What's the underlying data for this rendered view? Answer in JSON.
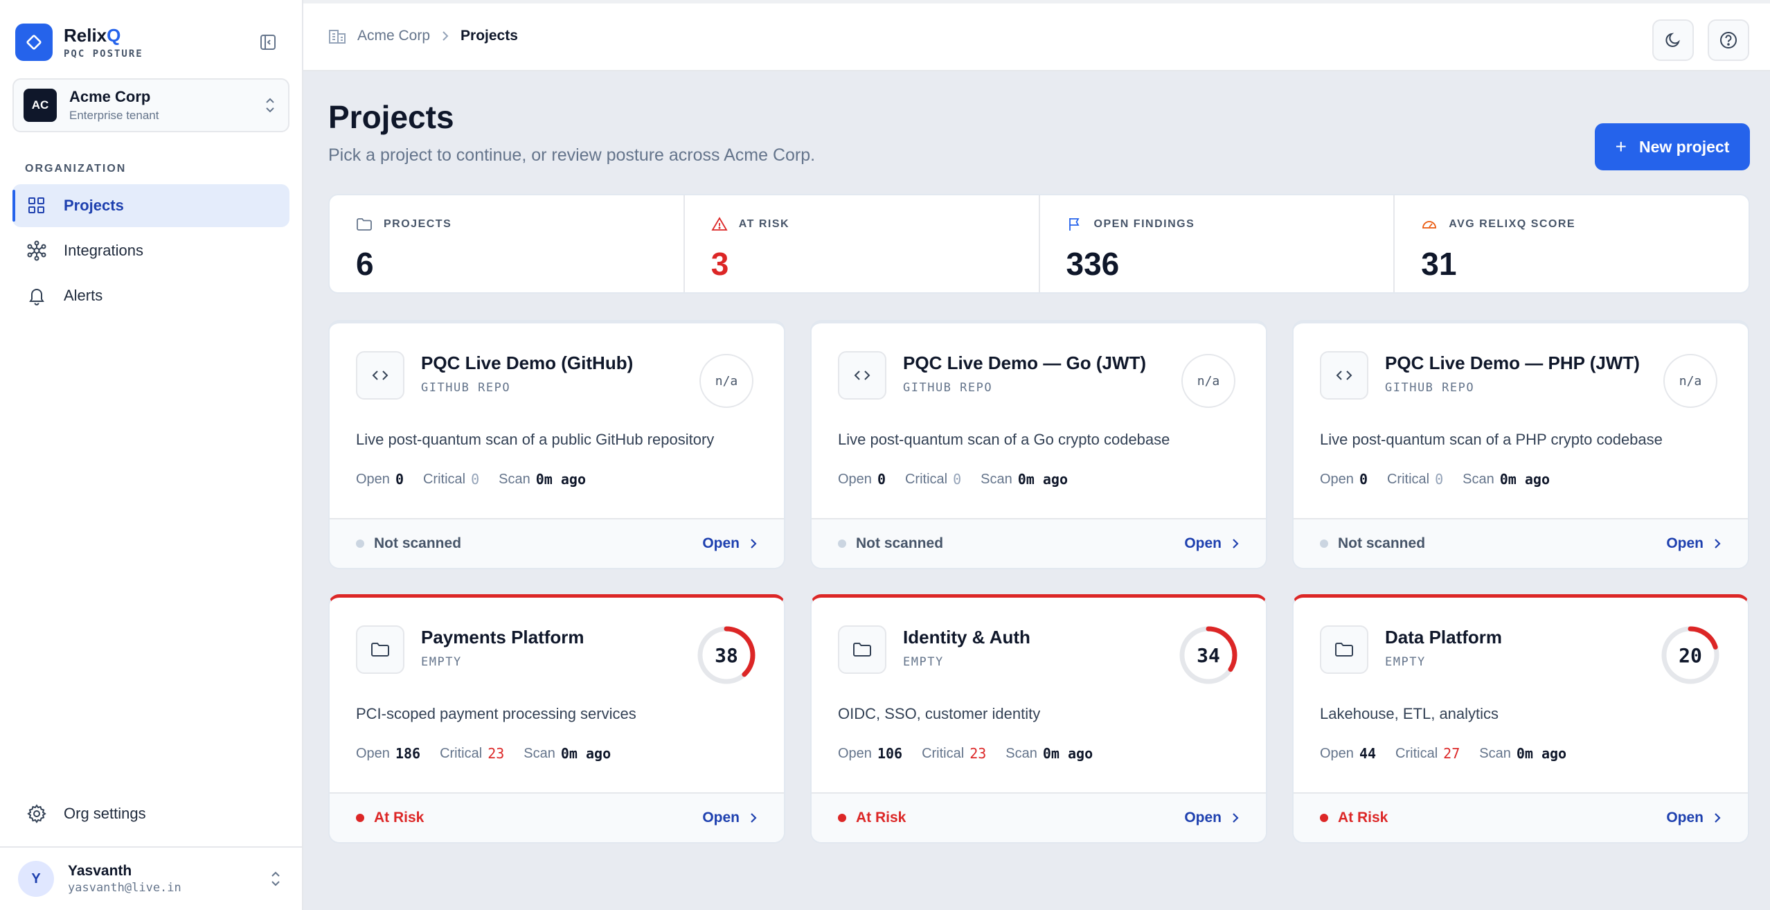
{
  "brand": {
    "name_main": "Relix",
    "name_accent": "Q",
    "subtitle": "PQC POSTURE"
  },
  "tenant": {
    "initials": "AC",
    "name": "Acme Corp",
    "subtitle": "Enterprise tenant"
  },
  "sidebar": {
    "section_label": "ORGANIZATION",
    "items": [
      {
        "label": "Projects",
        "icon": "grid-icon",
        "active": true
      },
      {
        "label": "Integrations",
        "icon": "network-icon",
        "active": false
      },
      {
        "label": "Alerts",
        "icon": "bell-icon",
        "active": false
      }
    ],
    "settings_label": "Org settings"
  },
  "user": {
    "initial": "Y",
    "name": "Yasvanth",
    "email": "yasvanth@live.in"
  },
  "breadcrumb": {
    "org": "Acme Corp",
    "current": "Projects"
  },
  "page": {
    "title": "Projects",
    "subtitle": "Pick a project to continue, or review posture across Acme Corp.",
    "new_button": "New project"
  },
  "stats": [
    {
      "label": "PROJECTS",
      "value": "6",
      "icon": "folder-icon"
    },
    {
      "label": "AT RISK",
      "value": "3",
      "icon": "warning-icon"
    },
    {
      "label": "OPEN FINDINGS",
      "value": "336",
      "icon": "flag-icon"
    },
    {
      "label": "AVG RELIXQ SCORE",
      "value": "31",
      "icon": "gauge-icon"
    }
  ],
  "colors": {
    "accent": "#2563eb",
    "danger": "#dc2626",
    "neutral_dot": "#cbd5e1"
  },
  "projects": [
    {
      "title": "PQC Live Demo (GitHub)",
      "type": "GITHUB REPO",
      "icon": "code-icon",
      "score": "n/a",
      "score_value": null,
      "description": "Live post-quantum scan of a public GitHub repository",
      "open_label": "Open",
      "open_value": "0",
      "critical_label": "Critical",
      "critical_value": "0",
      "scan_label": "Scan",
      "scan_value": "0m ago",
      "status": "Not scanned",
      "action": "Open"
    },
    {
      "title": "PQC Live Demo — Go (JWT)",
      "type": "GITHUB REPO",
      "icon": "code-icon",
      "score": "n/a",
      "score_value": null,
      "description": "Live post-quantum scan of a Go crypto codebase",
      "open_label": "Open",
      "open_value": "0",
      "critical_label": "Critical",
      "critical_value": "0",
      "scan_label": "Scan",
      "scan_value": "0m ago",
      "status": "Not scanned",
      "action": "Open"
    },
    {
      "title": "PQC Live Demo — PHP (JWT)",
      "type": "GITHUB REPO",
      "icon": "code-icon",
      "score": "n/a",
      "score_value": null,
      "description": "Live post-quantum scan of a PHP crypto codebase",
      "open_label": "Open",
      "open_value": "0",
      "critical_label": "Critical",
      "critical_value": "0",
      "scan_label": "Scan",
      "scan_value": "0m ago",
      "status": "Not scanned",
      "action": "Open"
    },
    {
      "title": "Payments Platform",
      "type": "EMPTY",
      "icon": "folder-icon",
      "score": "38",
      "score_value": 38,
      "description": "PCI-scoped payment processing services",
      "open_label": "Open",
      "open_value": "186",
      "critical_label": "Critical",
      "critical_value": "23",
      "scan_label": "Scan",
      "scan_value": "0m ago",
      "status": "At Risk",
      "action": "Open"
    },
    {
      "title": "Identity & Auth",
      "type": "EMPTY",
      "icon": "folder-icon",
      "score": "34",
      "score_value": 34,
      "description": "OIDC, SSO, customer identity",
      "open_label": "Open",
      "open_value": "106",
      "critical_label": "Critical",
      "critical_value": "23",
      "scan_label": "Scan",
      "scan_value": "0m ago",
      "status": "At Risk",
      "action": "Open"
    },
    {
      "title": "Data Platform",
      "type": "EMPTY",
      "icon": "folder-icon",
      "score": "20",
      "score_value": 20,
      "description": "Lakehouse, ETL, analytics",
      "open_label": "Open",
      "open_value": "44",
      "critical_label": "Critical",
      "critical_value": "27",
      "scan_label": "Scan",
      "scan_value": "0m ago",
      "status": "At Risk",
      "action": "Open"
    }
  ]
}
